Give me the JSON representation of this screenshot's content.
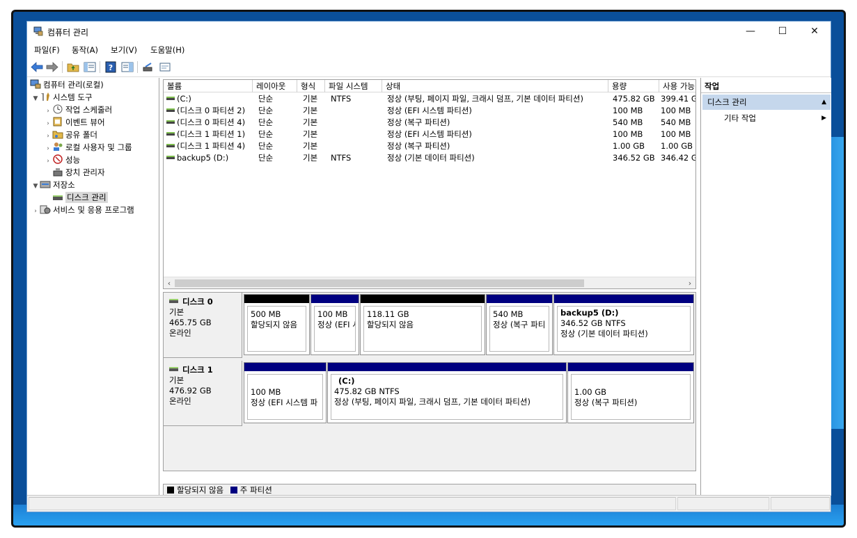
{
  "window": {
    "title": "컴퓨터 관리",
    "minimize": "—",
    "maximize": "☐",
    "close": "✕"
  },
  "menu": [
    "파일(F)",
    "동작(A)",
    "보기(V)",
    "도움말(H)"
  ],
  "toolbar_icons": [
    "back-icon",
    "forward-icon",
    "up-folder-icon",
    "show-hide-tree-icon",
    "help-icon",
    "show-hide-action-pane-icon",
    "rescan-icon",
    "properties-icon"
  ],
  "tree": {
    "root": "컴퓨터 관리(로컬)",
    "system_tools": "시스템 도구",
    "task_scheduler": "작업 스케줄러",
    "event_viewer": "이벤트 뷰어",
    "shared_folders": "공유 폴더",
    "local_users": "로컬 사용자 및 그룹",
    "performance": "성능",
    "device_manager": "장치 관리자",
    "storage": "저장소",
    "disk_management": "디스크 관리",
    "services": "서비스 및 응용 프로그램"
  },
  "volumes": {
    "headers": [
      "볼륨",
      "레이아웃",
      "형식",
      "파일 시스템",
      "상태",
      "용량",
      "사용 가능"
    ],
    "rows": [
      [
        "(C:)",
        "단순",
        "기본",
        "NTFS",
        "정상 (부팅, 페이지 파일, 크래시 덤프, 기본 데이터 파티션)",
        "475.82 GB",
        "399.41 G"
      ],
      [
        "(디스크 0 파티션 2)",
        "단순",
        "기본",
        "",
        "정상 (EFI 시스템 파티션)",
        "100 MB",
        "100 MB"
      ],
      [
        "(디스크 0 파티션 4)",
        "단순",
        "기본",
        "",
        "정상 (복구 파티션)",
        "540 MB",
        "540 MB"
      ],
      [
        "(디스크 1 파티션 1)",
        "단순",
        "기본",
        "",
        "정상 (EFI 시스템 파티션)",
        "100 MB",
        "100 MB"
      ],
      [
        "(디스크 1 파티션 4)",
        "단순",
        "기본",
        "",
        "정상 (복구 파티션)",
        "1.00 GB",
        "1.00 GB"
      ],
      [
        "backup5 (D:)",
        "단순",
        "기본",
        "NTFS",
        "정상 (기본 데이터 파티션)",
        "346.52 GB",
        "346.42 G"
      ]
    ]
  },
  "disks": [
    {
      "name": "디스크 0",
      "type": "기본",
      "size": "465.75 GB",
      "status": "온라인",
      "partitions": [
        {
          "name": "",
          "size": "500 MB",
          "desc": "할당되지 않음",
          "kind": "unallocated"
        },
        {
          "name": "",
          "size": "100 MB",
          "desc": "정상 (EFI 시",
          "kind": "primary"
        },
        {
          "name": "",
          "size": "118.11 GB",
          "desc": "할당되지 않음",
          "kind": "unallocated"
        },
        {
          "name": "",
          "size": "540 MB",
          "desc": "정상 (복구 파티",
          "kind": "primary"
        },
        {
          "name": "backup5  (D:)",
          "size": "346.52 GB NTFS",
          "desc": "정상 (기본 데이터 파티션)",
          "kind": "primary"
        }
      ]
    },
    {
      "name": "디스크 1",
      "type": "기본",
      "size": "476.92 GB",
      "status": "온라인",
      "partitions": [
        {
          "name": "",
          "size": "100 MB",
          "desc": "정상 (EFI 시스템 파",
          "kind": "primary"
        },
        {
          "name": "(C:)",
          "size": "475.82 GB NTFS",
          "desc": "정상 (부팅, 페이지 파일, 크래시 덤프, 기본 데이터 파티션)",
          "kind": "primary"
        },
        {
          "name": "",
          "size": "1.00 GB",
          "desc": "정상 (복구 파티션)",
          "kind": "primary"
        }
      ]
    }
  ],
  "legend": {
    "unallocated": "할당되지 않음",
    "primary": "주 파티션"
  },
  "colors": {
    "unallocated": "#000000",
    "primary": "#000080",
    "action_header": "#c5d7ec"
  },
  "actions": {
    "title": "작업",
    "section": "디스크 관리",
    "more": "기타 작업"
  }
}
